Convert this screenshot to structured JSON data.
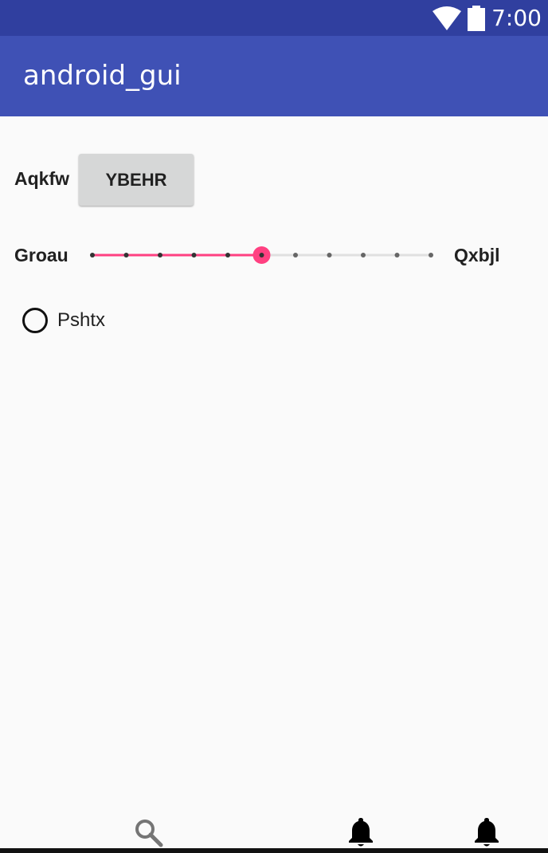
{
  "status_bar": {
    "time": "7:00",
    "icons": [
      "wifi-icon",
      "battery-icon"
    ]
  },
  "app_bar": {
    "title": "android_gui"
  },
  "row1": {
    "label": "Aqkfw",
    "button_label": "YBEHR"
  },
  "slider": {
    "left_label": "Groau",
    "right_label": "Qxbjl",
    "steps": 10,
    "value": 5,
    "accent": "#ff4081"
  },
  "radio": {
    "label": "Pshtx",
    "checked": false
  },
  "bottom_nav": {
    "icons": [
      "search-icon",
      "bell-icon",
      "bell-icon"
    ]
  },
  "colors": {
    "status_bar": "#303f9f",
    "app_bar": "#3f51b5",
    "background": "#fafafa"
  }
}
